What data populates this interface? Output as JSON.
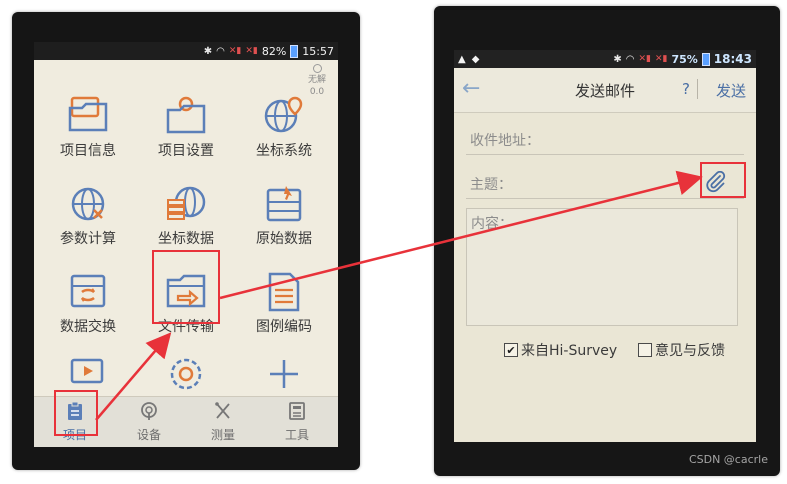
{
  "left_phone": {
    "status_bar": {
      "battery": "82%",
      "time": "15:57"
    },
    "corner_status": {
      "label": "无解",
      "value": "0.0"
    },
    "menu_items": [
      {
        "label": "项目信息",
        "icon": "folder-info-icon"
      },
      {
        "label": "项目设置",
        "icon": "folder-gear-icon"
      },
      {
        "label": "坐标系统",
        "icon": "globe-location-icon"
      },
      {
        "label": "参数计算",
        "icon": "globe-calc-icon"
      },
      {
        "label": "坐标数据",
        "icon": "coordinate-data-icon"
      },
      {
        "label": "原始数据",
        "icon": "raw-data-icon"
      },
      {
        "label": "数据交换",
        "icon": "data-exchange-icon"
      },
      {
        "label": "文件传输",
        "icon": "file-transfer-icon"
      },
      {
        "label": "图例编码",
        "icon": "legend-code-icon"
      }
    ],
    "extra_row_icons": [
      "video-icon",
      "settings-bulb-icon",
      "plus-icon"
    ],
    "bottom_tabs": [
      {
        "label": "项目",
        "icon": "project-icon"
      },
      {
        "label": "设备",
        "icon": "device-icon"
      },
      {
        "label": "测量",
        "icon": "measure-icon"
      },
      {
        "label": "工具",
        "icon": "tools-icon"
      }
    ]
  },
  "right_phone": {
    "status_bar": {
      "battery": "75%",
      "time": "18:43"
    },
    "header": {
      "title": "发送邮件",
      "back_glyph": "←",
      "help_label": "?",
      "send_label": "发送"
    },
    "fields": {
      "recipient_label": "收件地址：",
      "subject_label": "主题：",
      "content_label": "内容："
    },
    "checkboxes": [
      {
        "label": "来自Hi-Survey",
        "checked": true
      },
      {
        "label": "意见与反馈",
        "checked": false
      }
    ]
  },
  "watermark": "CSDN @cacrle",
  "colors": {
    "highlight": "#e8323a",
    "icon_blue": "#5b7fb8",
    "icon_orange": "#e07a3a"
  }
}
